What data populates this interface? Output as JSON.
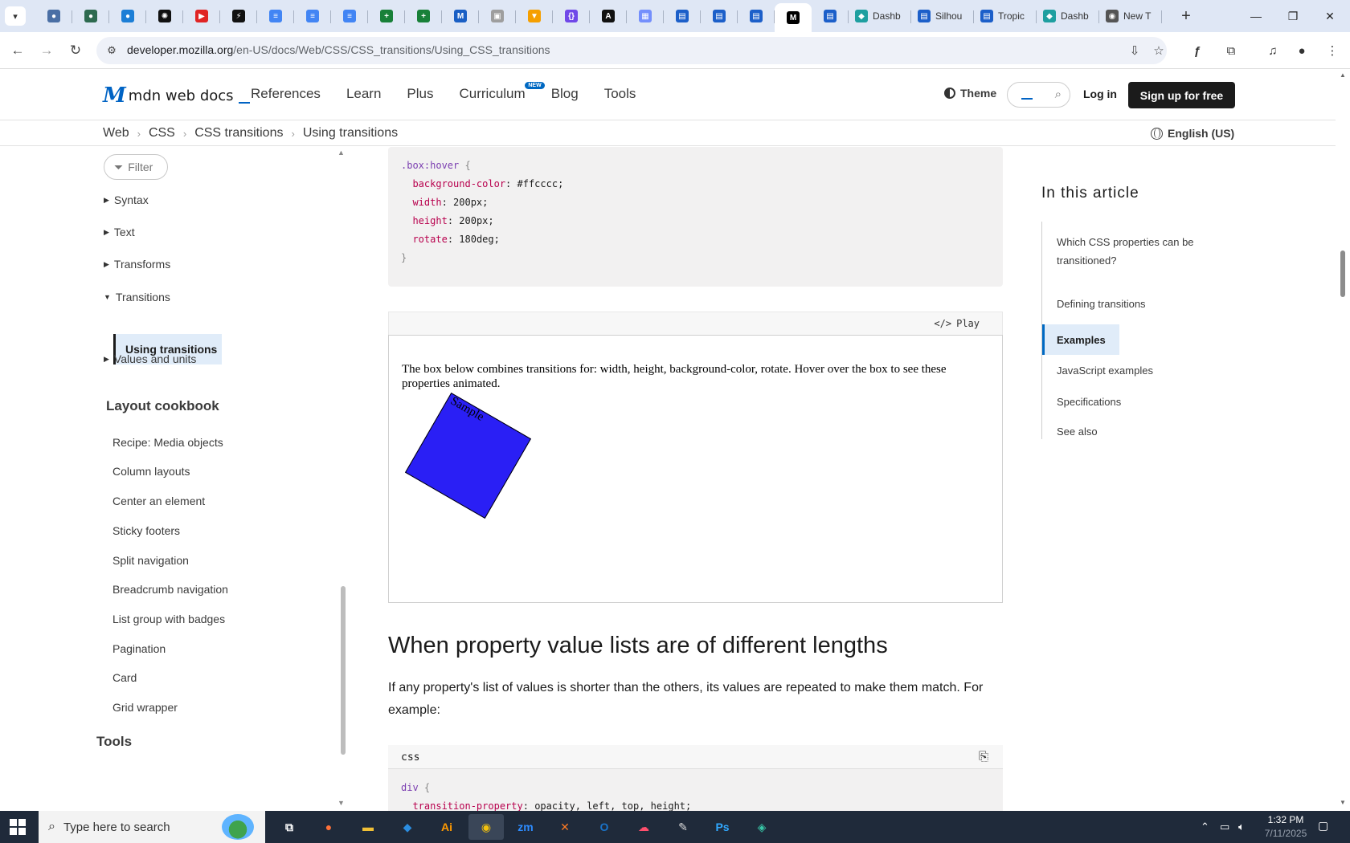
{
  "browser": {
    "tabs": [
      {
        "icon": "tab-icon-1",
        "color": "#4a6fa5"
      },
      {
        "icon": "tab-icon-2",
        "color": "#2d6a4f"
      },
      {
        "icon": "tab-icon-3",
        "color": "#1c7ed6"
      },
      {
        "icon": "tab-icon-openai",
        "color": "#111111"
      },
      {
        "icon": "youtube-icon",
        "color": "#e02424"
      },
      {
        "icon": "bolt-icon",
        "color": "#111111"
      },
      {
        "icon": "docs-icon",
        "color": "#4285f4"
      },
      {
        "icon": "docs-icon",
        "color": "#4285f4"
      },
      {
        "icon": "docs-icon",
        "color": "#4285f4"
      },
      {
        "icon": "sheets-icon",
        "color": "#188038"
      },
      {
        "icon": "sheets-icon",
        "color": "#188038"
      },
      {
        "icon": "mdn-icon",
        "color": "#1a5fc4"
      },
      {
        "icon": "image-icon",
        "color": "#9e9e9e"
      },
      {
        "icon": "bookmark-icon",
        "color": "#f59f00"
      },
      {
        "icon": "braces-icon",
        "color": "#7048e8"
      },
      {
        "icon": "angular-icon",
        "color": "#111111"
      },
      {
        "icon": "grid-icon",
        "color": "#748ffc"
      },
      {
        "icon": "forms-icon",
        "color": "#1c5fc9"
      },
      {
        "icon": "forms-icon",
        "color": "#1c5fc9"
      },
      {
        "icon": "forms-icon",
        "color": "#1c5fc9"
      }
    ],
    "active_tab_icon": "mdn-icon",
    "tab_after_active": {
      "icon": "forms-icon",
      "color": "#1c5fc9"
    },
    "named_tabs": [
      {
        "label": "Dashb",
        "icon": "dashboard-icon",
        "color": "#1e9fa0"
      },
      {
        "label": "Silhou",
        "icon": "forms-icon",
        "color": "#1c5fc9"
      },
      {
        "label": "Tropic",
        "icon": "forms-icon",
        "color": "#1c5fc9"
      },
      {
        "label": "Dashb",
        "icon": "dashboard-icon",
        "color": "#1e9fa0"
      },
      {
        "label": "New T",
        "icon": "chrome-icon",
        "color": "#555555"
      }
    ],
    "url_host": "developer.mozilla.org",
    "url_path": "/en-US/docs/Web/CSS/CSS_transitions/Using_CSS_transitions"
  },
  "header": {
    "logo_text": "mdn web docs",
    "nav": [
      "References",
      "Learn",
      "Plus",
      "Curriculum",
      "Blog",
      "Tools"
    ],
    "new_badge": "NEW",
    "theme_label": "Theme",
    "login_label": "Log in",
    "signup_label": "Sign up for free"
  },
  "breadcrumbs": [
    "Web",
    "CSS",
    "CSS transitions",
    "Using transitions"
  ],
  "language": "English (US)",
  "sidebar": {
    "filter_label": "Filter",
    "groups": [
      {
        "label": "Syntax",
        "expanded": false
      },
      {
        "label": "Text",
        "expanded": false
      },
      {
        "label": "Transforms",
        "expanded": false
      },
      {
        "label": "Transitions",
        "expanded": true
      }
    ],
    "active_item": "Using transitions",
    "after_group": {
      "label": "Values and units",
      "expanded": false
    },
    "section_heading": "Layout cookbook",
    "items": [
      "Recipe: Media objects",
      "Column layouts",
      "Center an element",
      "Sticky footers",
      "Split navigation",
      "Breadcrumb navigation",
      "List group with badges",
      "Pagination",
      "Card",
      "Grid wrapper"
    ],
    "bottom_heading": "Tools"
  },
  "main": {
    "code1": {
      "selector": ".box:hover",
      "lines": [
        {
          "prop": "background-color",
          "value": "#ffcccc"
        },
        {
          "prop": "width",
          "value": "200px"
        },
        {
          "prop": "height",
          "value": "200px"
        },
        {
          "prop": "rotate",
          "value": "180deg"
        }
      ]
    },
    "play_label": "Play",
    "example_text": "The box below combines transitions for: width, height, background-color, rotate. Hover over the box to see these properties animated.",
    "demo_box_label": "Sample",
    "demo_box_color": "#2a1ff5",
    "section_title": "When property value lists are of different lengths",
    "section_paragraph": "If any property's list of values is shorter than the others, its values are repeated to make them match. For example:",
    "code2_lang": "css",
    "code2": {
      "selector": "div",
      "first_prop": "transition-property",
      "first_value": "opacity, left, top, height;"
    }
  },
  "toc": {
    "title": "In this article",
    "items": [
      "Which CSS properties can be transitioned?",
      "Defining transitions"
    ],
    "active": "Examples",
    "items_after": [
      "JavaScript examples",
      "Specifications",
      "See also"
    ]
  },
  "taskbar": {
    "search_placeholder": "Type here to search",
    "apps": [
      {
        "name": "task-view-icon",
        "glyph": "⧉",
        "color": "#ffffff"
      },
      {
        "name": "firefox-icon",
        "glyph": "●",
        "color": "#ff7139"
      },
      {
        "name": "file-explorer-icon",
        "glyph": "▬",
        "color": "#f0c036"
      },
      {
        "name": "vscode-icon",
        "glyph": "◆",
        "color": "#2b8de0"
      },
      {
        "name": "illustrator-icon",
        "glyph": "Ai",
        "color": "#ff9a00"
      },
      {
        "name": "chrome-icon",
        "glyph": "◉",
        "color": "#f4c20d"
      },
      {
        "name": "zoom-icon",
        "glyph": "zm",
        "color": "#2d8cff"
      },
      {
        "name": "xampp-icon",
        "glyph": "✕",
        "color": "#fb7a24"
      },
      {
        "name": "outlook-icon",
        "glyph": "O",
        "color": "#1a73c8"
      },
      {
        "name": "creative-cloud-icon",
        "glyph": "☁",
        "color": "#ff4f6d"
      },
      {
        "name": "pen-icon",
        "glyph": "✎",
        "color": "#dddddd"
      },
      {
        "name": "photoshop-icon",
        "glyph": "Ps",
        "color": "#31a8ff"
      },
      {
        "name": "app-icon",
        "glyph": "◈",
        "color": "#38c8a8"
      }
    ],
    "active_app": "chrome-icon",
    "time": "1:32 PM",
    "date": "7/11/2025"
  }
}
